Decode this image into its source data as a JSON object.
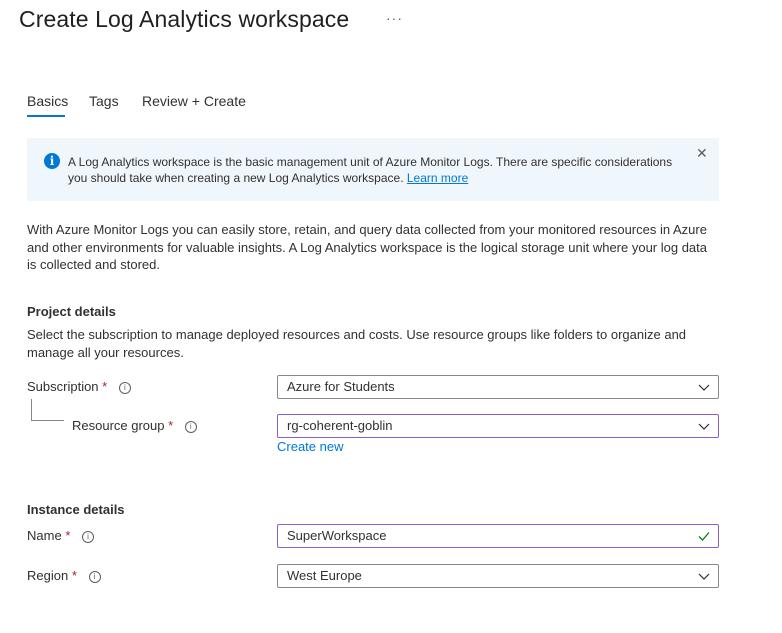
{
  "page": {
    "title": "Create Log Analytics workspace",
    "more_label": "···"
  },
  "tabs": [
    {
      "label": "Basics",
      "active": true
    },
    {
      "label": "Tags",
      "active": false
    },
    {
      "label": "Review + Create",
      "active": false
    }
  ],
  "info": {
    "text": "A Log Analytics workspace is the basic management unit of Azure Monitor Logs. There are specific considerations you should take when creating a new Log Analytics workspace.",
    "link": "Learn more",
    "icon": "info-icon",
    "close": "✕"
  },
  "intro": "With Azure Monitor Logs you can easily store, retain, and query data collected from your monitored resources in Azure and other environments for valuable insights. A Log Analytics workspace is the logical storage unit where your log data is collected and stored.",
  "project": {
    "heading": "Project details",
    "description": "Select the subscription to manage deployed resources and costs. Use resource groups like folders to organize and manage all your resources.",
    "subscription": {
      "label": "Subscription",
      "required": "*",
      "value": "Azure for Students"
    },
    "resource_group": {
      "label": "Resource group",
      "required": "*",
      "value": "rg-coherent-goblin",
      "create_new": "Create new"
    }
  },
  "instance": {
    "heading": "Instance details",
    "name": {
      "label": "Name",
      "required": "*",
      "value": "SuperWorkspace",
      "valid": true
    },
    "region": {
      "label": "Region",
      "required": "*",
      "value": "West Europe"
    }
  },
  "colors": {
    "accent": "#0078d4",
    "focus": "#8661c5",
    "required": "#a4262c",
    "valid": "#107c10",
    "info_bg": "#eff6fc"
  }
}
